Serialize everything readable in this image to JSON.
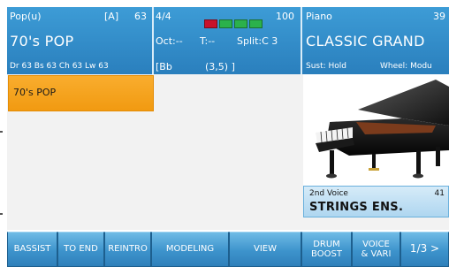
{
  "header": {
    "style_bank": "Pop(u)",
    "variation": "[A]",
    "style_number": "63",
    "style_name": "70's POP",
    "style_params": "Dr 63  Bs 63  Ch 63  Lw 63",
    "time_signature": "4/4",
    "tempo": "100",
    "octave": "Oct:--",
    "transpose": "T:--",
    "split": "Split:C 3",
    "chord": "[Bb",
    "chord_pos": "(3,5) ]",
    "voice_bank": "Piano",
    "voice_number": "39",
    "voice_name": "CLASSIC GRAND",
    "sustain": "Sust: Hold",
    "wheel": "Wheel: Modu"
  },
  "main": {
    "selected_style": "70's POP",
    "second_voice": {
      "caption": "2nd Voice",
      "number": "41",
      "name": "STRINGS ENS."
    }
  },
  "buttons": {
    "bassist": "BASSIST",
    "to_end": "TO END",
    "reintro": "REINTRO",
    "modeling": "MODELING",
    "view": "VIEW",
    "drum_boost": "DRUM BOOST",
    "voice_vari": "VOICE & VARI",
    "page": "1/3 >"
  },
  "colors": {
    "header_blue": "#2f86c4",
    "button_blue": "#3d93cc",
    "style_tile_orange": "#f5a21c",
    "meter_red": "#c8112b",
    "meter_green": "#2bb14b"
  }
}
